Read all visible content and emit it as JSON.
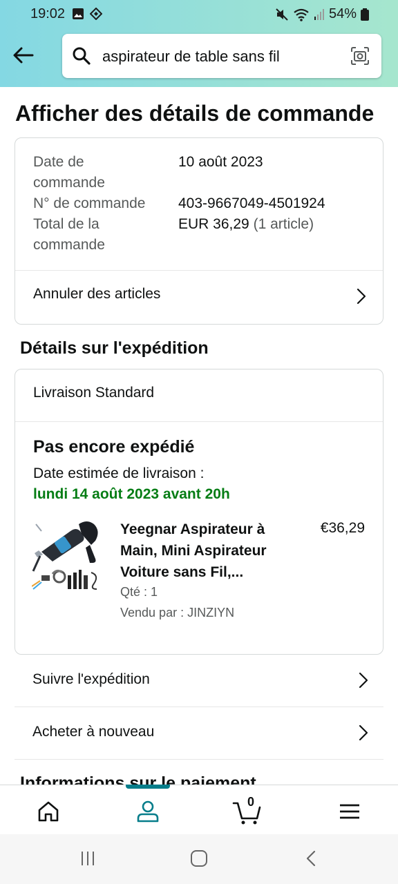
{
  "status": {
    "time": "19:02",
    "battery": "54%"
  },
  "search": {
    "query": "aspirateur de table sans fil"
  },
  "page": {
    "title": "Afficher des détails de commande"
  },
  "order": {
    "date_label": "Date de commande",
    "date_value": "10 août 2023",
    "number_label": "N° de commande",
    "number_value": "403-9667049-4501924",
    "total_label": "Total de la commande",
    "total_value": "EUR 36,29",
    "total_items": "(1 article)",
    "cancel_label": "Annuler des articles"
  },
  "shipping": {
    "section_title": "Détails sur l'expédition",
    "type": "Livraison Standard",
    "status": "Pas encore expédié",
    "estimate_label": "Date estimée de livraison :",
    "estimate_date": "lundi 14 août 2023 avant 20h",
    "product": {
      "title": "Yeegnar Aspirateur à Main, Mini Aspirateur Voiture sans Fil,...",
      "price": "€36,29",
      "qty": "Qté : 1",
      "seller": "Vendu par : JINZIYN"
    }
  },
  "actions": {
    "track": "Suivre l'expédition",
    "buy_again": "Acheter à nouveau"
  },
  "payment": {
    "section_title": "Informations sur le paiement"
  },
  "bottom_nav": {
    "cart_count": "0",
    "active": "account"
  },
  "colors": {
    "delivery_green": "#067d15",
    "active_tab": "#067d8a"
  }
}
